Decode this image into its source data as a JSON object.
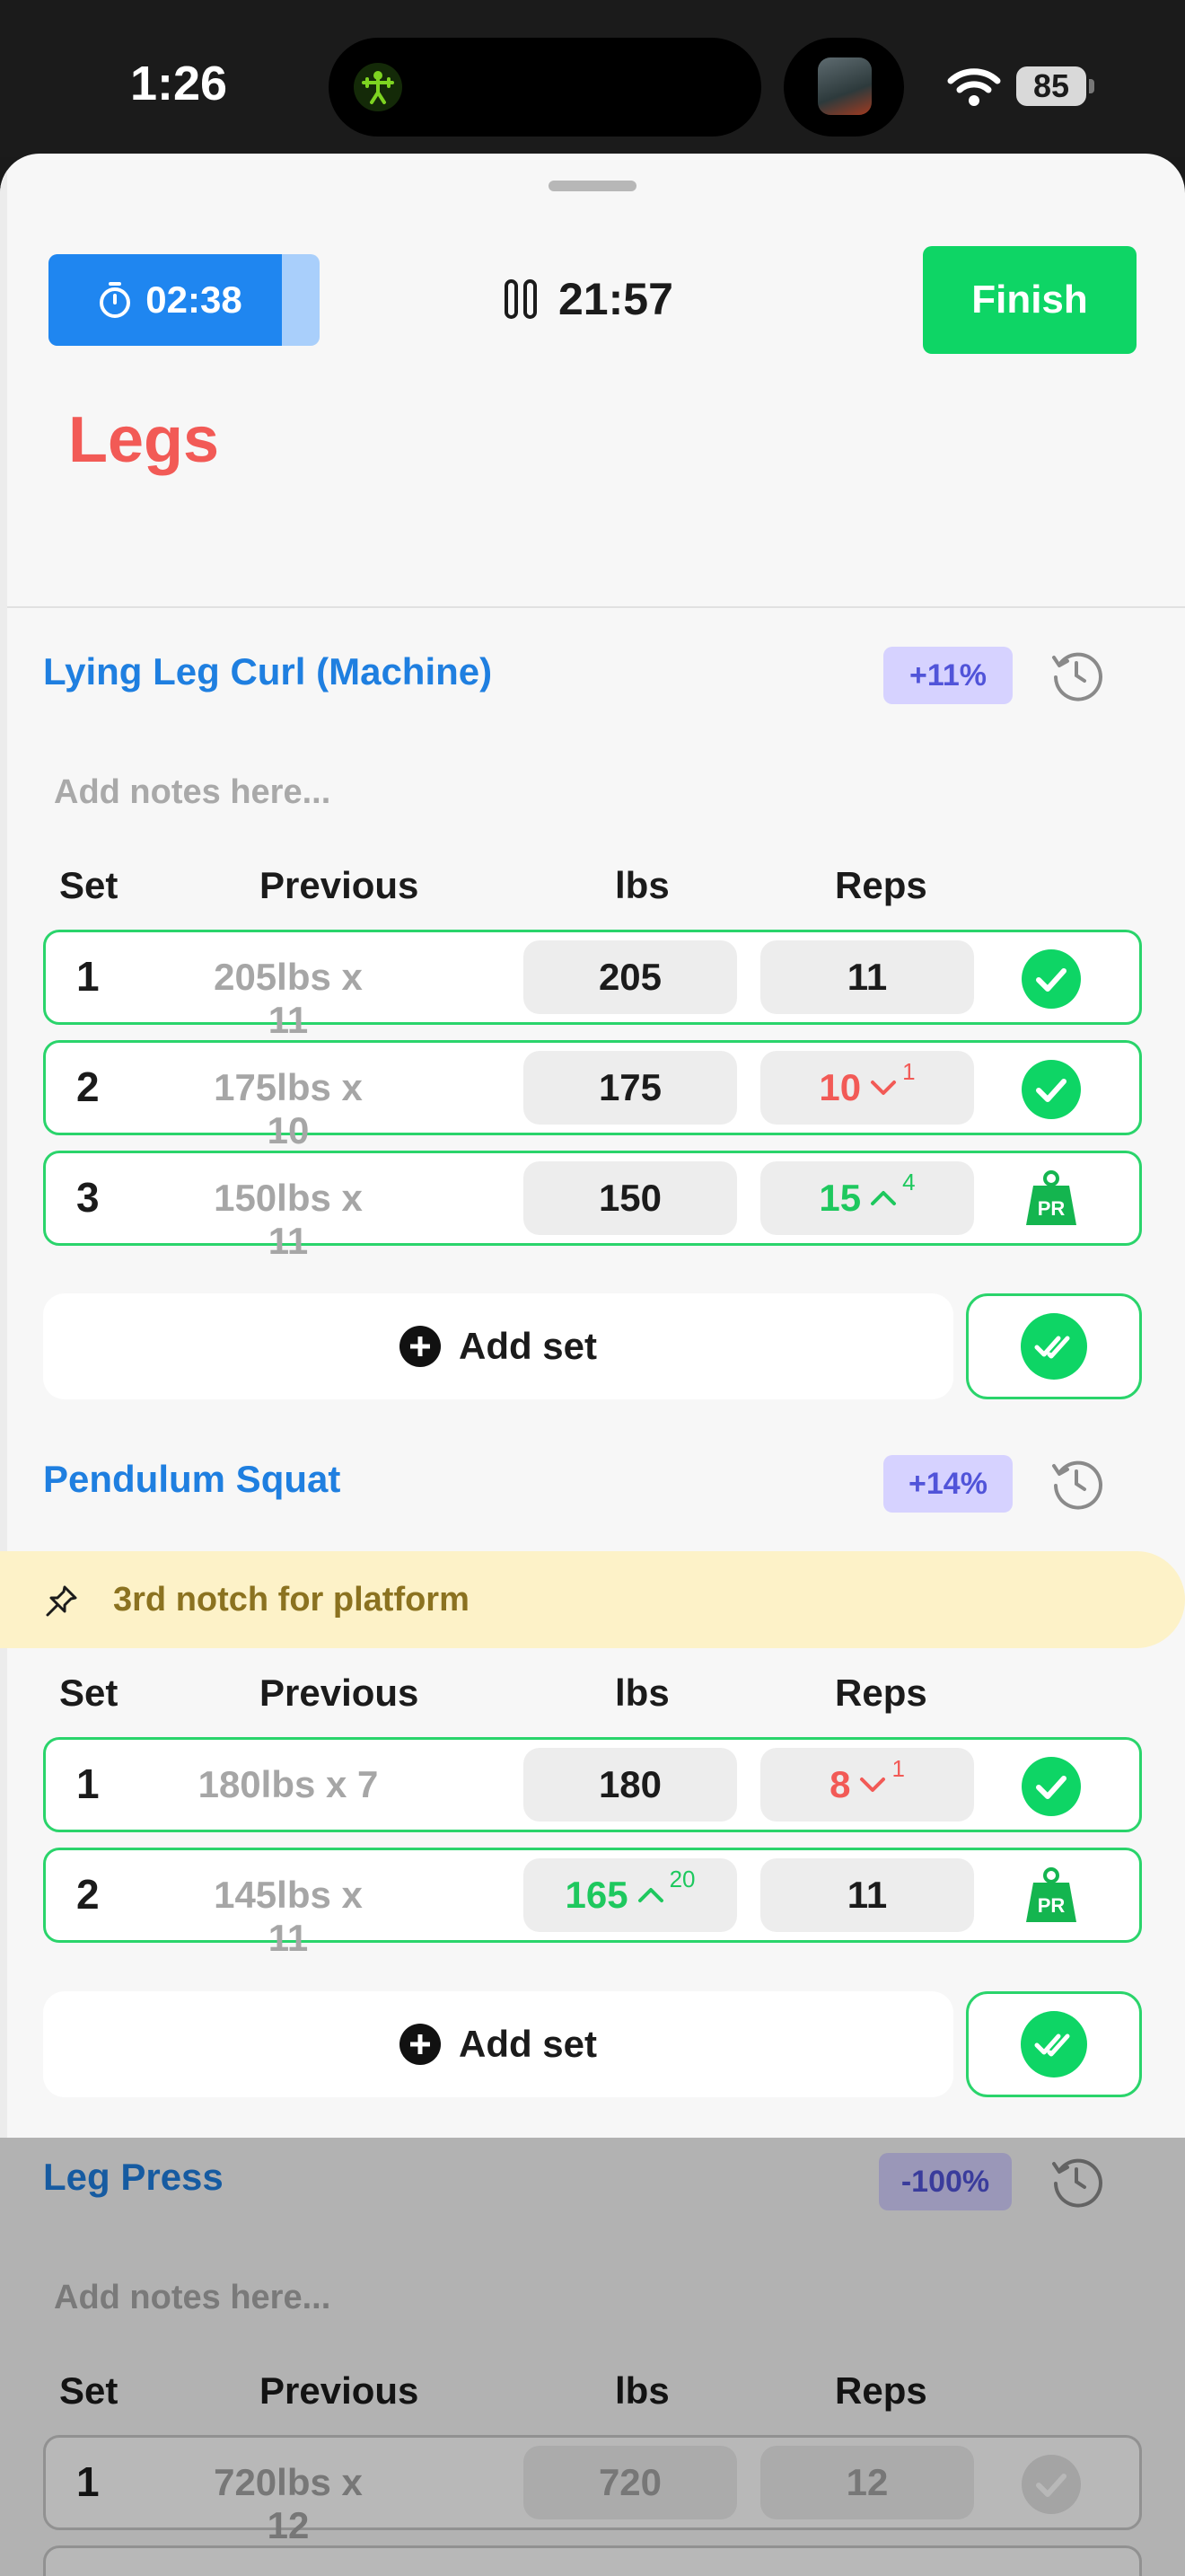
{
  "status_bar": {
    "time": "1:26",
    "battery": "85",
    "activity_icon": "weightlifter-icon",
    "now_playing_icon": "album-art"
  },
  "header": {
    "rest_timer": "02:38",
    "rest_progress": 0.86,
    "workout_timer": "21:57",
    "finish_label": "Finish",
    "title": "Legs"
  },
  "columns": {
    "set": "Set",
    "previous": "Previous",
    "lbs": "lbs",
    "reps": "Reps"
  },
  "exercises": [
    {
      "name": "Lying Leg Curl (Machine)",
      "badge": "+11%",
      "notes_placeholder": "Add notes here...",
      "sets": [
        {
          "num": "1",
          "previous": "205lbs x 11",
          "lbs": "205",
          "reps": "11",
          "status": "done"
        },
        {
          "num": "2",
          "previous": "175lbs x 10",
          "lbs": "175",
          "reps": "10",
          "reps_delta": "1",
          "status": "done"
        },
        {
          "num": "3",
          "previous": "150lbs x 11",
          "lbs": "150",
          "reps": "15",
          "reps_delta": "4",
          "status": "pr"
        }
      ],
      "add_set_label": "Add set"
    },
    {
      "name": "Pendulum Squat",
      "badge": "+14%",
      "pinned_note": "3rd notch for platform",
      "sets": [
        {
          "num": "1",
          "previous": "180lbs x 7",
          "lbs": "180",
          "reps": "8",
          "reps_delta": "1",
          "status": "done"
        },
        {
          "num": "2",
          "previous": "145lbs x 11",
          "lbs": "165",
          "lbs_delta": "20",
          "reps": "11",
          "status": "pr"
        }
      ],
      "add_set_label": "Add set"
    },
    {
      "name": "Leg Press",
      "badge": "-100%",
      "notes_placeholder": "Add notes here...",
      "sets": [
        {
          "num": "1",
          "previous": "720lbs x 12",
          "lbs": "720",
          "reps": "12",
          "status": "pending"
        }
      ]
    }
  ],
  "pr_label": "PR",
  "colors": {
    "accent_green": "#0ed565",
    "accent_blue": "#1f86f0",
    "title_red": "#f25a56",
    "link_blue": "#1f7fe0"
  }
}
